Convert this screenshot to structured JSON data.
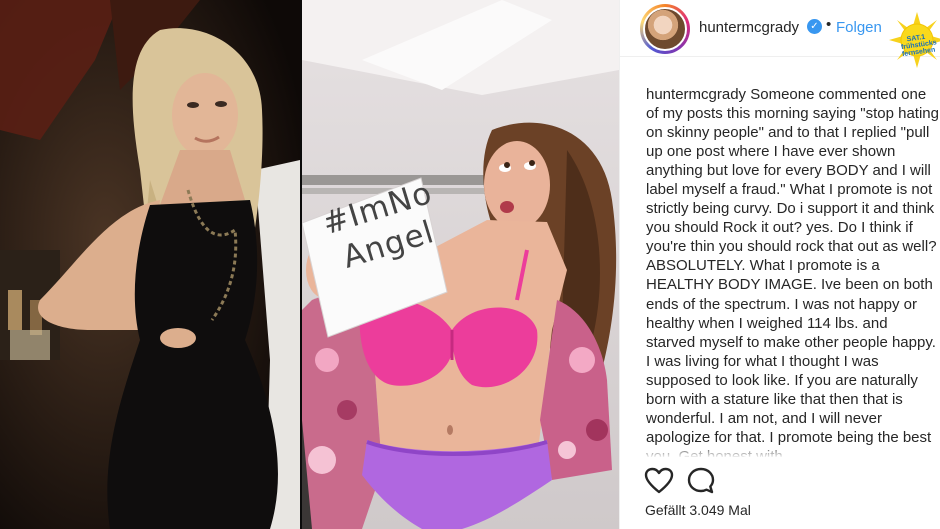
{
  "post": {
    "username": "huntermcgrady",
    "follow_label": "Folgen",
    "verified_icon": "verified-badge-icon",
    "caption_username": "huntermcgrady",
    "caption_text": " Someone commented one of my posts this morning saying \"stop hating on skinny people\" and to that I replied \"pull up one post where I have ever shown anything but love for every BODY and I will label myself a fraud.\" What I promote is not strictly being curvy. Do i support it and think you should Rock it out? yes. Do I think if you're thin you should rock that out as well? ABSOLUTELY. What I promote is a HEALTHY BODY IMAGE. Ive been on both ends of the spectrum. I was not happy or healthy when I weighed 114 lbs. and starved myself to make other people happy. I was living for what I thought I was supposed to look like. If you are naturally born with a stature like that then that is wonderful. I am not, and I will never apologize for that. I promote being the best you. Get honest with",
    "likes_label": "Gefällt 3.049 Mal"
  },
  "photo": {
    "sign_text": "#ImNo Angel"
  },
  "watermark": {
    "text": "SAT.1 frühstücks fernsehen"
  },
  "icons": {
    "like": "heart-icon",
    "comment": "comment-icon",
    "sun": "sun-logo-icon"
  },
  "colors": {
    "link_blue": "#3897f0",
    "bra_pink": "#ec3d9b",
    "underwear_purple": "#b067e0"
  }
}
